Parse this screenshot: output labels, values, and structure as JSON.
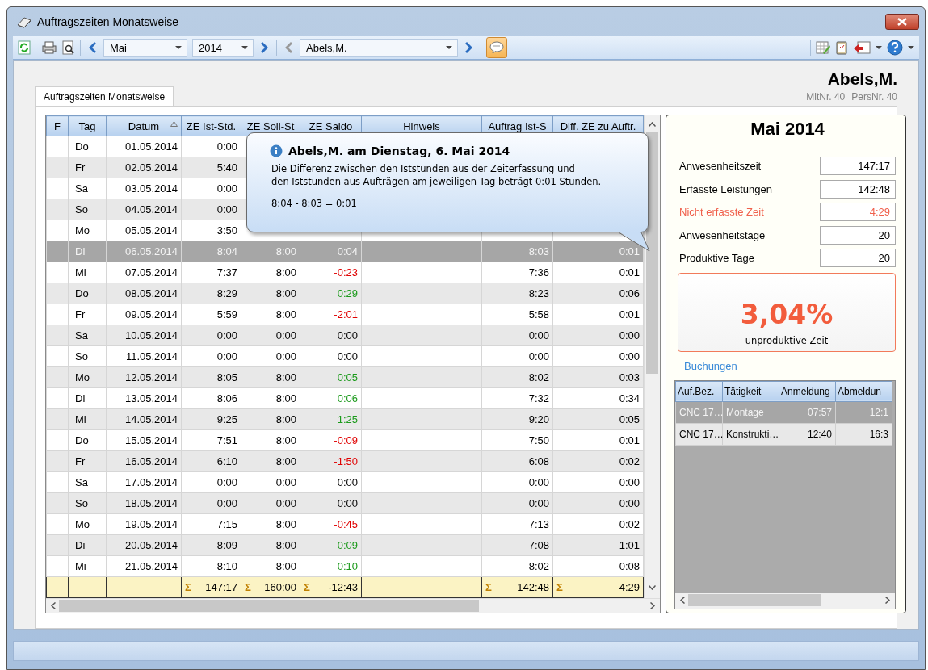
{
  "window": {
    "title": "Auftragszeiten Monatsweise"
  },
  "toolbar": {
    "month": "Mai",
    "year": "2014",
    "employee": "Abels,M.",
    "comments_on": true
  },
  "header": {
    "name": "Abels,M.",
    "mitnr": "MitNr. 40",
    "persnr": "PersNr. 40"
  },
  "tabs": [
    {
      "label": "Auftragszeiten Monatsweise",
      "selected": true
    }
  ],
  "table": {
    "columns": [
      "F",
      "Tag",
      "Datum",
      "ZE Ist-Std.",
      "ZE Soll-St",
      "ZE Saldo",
      "Hinweis",
      "Auftrag Ist-S",
      "Diff. ZE zu Auftr."
    ],
    "rows": [
      {
        "selected": false,
        "tag": "Do",
        "datum": "01.05.2014",
        "ze_ist_std": "0:00"
      },
      {
        "selected": false,
        "tag": "Fr",
        "datum": "02.05.2014",
        "ze_ist_std": "5:40"
      },
      {
        "selected": false,
        "tag": "Sa",
        "datum": "03.05.2014",
        "ze_ist_std": "0:00"
      },
      {
        "selected": false,
        "tag": "So",
        "datum": "04.05.2014",
        "ze_ist_std": "0:00"
      },
      {
        "selected": false,
        "tag": "Mo",
        "datum": "05.05.2014",
        "ze_ist_std": "3:50"
      },
      {
        "selected": true,
        "tag": "Di",
        "datum": "06.05.2014",
        "ze_ist_std": "8:04",
        "ze_soll_st": "8:00",
        "ze_saldo": "0:04",
        "auftrag_ist_s": "8:03",
        "diff_ze_zu_auftr": "0:01"
      },
      {
        "selected": false,
        "tag": "Mi",
        "datum": "07.05.2014",
        "ze_ist_std": "7:37",
        "ze_soll_st": "8:00",
        "ze_saldo": "-0:23",
        "auftrag_ist_s": "7:36",
        "diff_ze_zu_auftr": "0:01"
      },
      {
        "selected": false,
        "tag": "Do",
        "datum": "08.05.2014",
        "ze_ist_std": "8:29",
        "ze_soll_st": "8:00",
        "ze_saldo": "0:29",
        "auftrag_ist_s": "8:23",
        "diff_ze_zu_auftr": "0:06"
      },
      {
        "selected": false,
        "tag": "Fr",
        "datum": "09.05.2014",
        "ze_ist_std": "5:59",
        "ze_soll_st": "8:00",
        "ze_saldo": "-2:01",
        "auftrag_ist_s": "5:58",
        "diff_ze_zu_auftr": "0:01"
      },
      {
        "selected": false,
        "tag": "Sa",
        "datum": "10.05.2014",
        "ze_ist_std": "0:00",
        "ze_soll_st": "0:00",
        "ze_saldo": "0:00",
        "auftrag_ist_s": "0:00",
        "diff_ze_zu_auftr": "0:00"
      },
      {
        "selected": false,
        "tag": "So",
        "datum": "11.05.2014",
        "ze_ist_std": "0:00",
        "ze_soll_st": "0:00",
        "ze_saldo": "0:00",
        "auftrag_ist_s": "0:00",
        "diff_ze_zu_auftr": "0:00"
      },
      {
        "selected": false,
        "tag": "Mo",
        "datum": "12.05.2014",
        "ze_ist_std": "8:05",
        "ze_soll_st": "8:00",
        "ze_saldo": "0:05",
        "auftrag_ist_s": "8:02",
        "diff_ze_zu_auftr": "0:03"
      },
      {
        "selected": false,
        "tag": "Di",
        "datum": "13.05.2014",
        "ze_ist_std": "8:06",
        "ze_soll_st": "8:00",
        "ze_saldo": "0:06",
        "auftrag_ist_s": "7:32",
        "diff_ze_zu_auftr": "0:34"
      },
      {
        "selected": false,
        "tag": "Mi",
        "datum": "14.05.2014",
        "ze_ist_std": "9:25",
        "ze_soll_st": "8:00",
        "ze_saldo": "1:25",
        "auftrag_ist_s": "9:20",
        "diff_ze_zu_auftr": "0:05"
      },
      {
        "selected": false,
        "tag": "Do",
        "datum": "15.05.2014",
        "ze_ist_std": "7:51",
        "ze_soll_st": "8:00",
        "ze_saldo": "-0:09",
        "auftrag_ist_s": "7:50",
        "diff_ze_zu_auftr": "0:01"
      },
      {
        "selected": false,
        "tag": "Fr",
        "datum": "16.05.2014",
        "ze_ist_std": "6:10",
        "ze_soll_st": "8:00",
        "ze_saldo": "-1:50",
        "auftrag_ist_s": "6:08",
        "diff_ze_zu_auftr": "0:02"
      },
      {
        "selected": false,
        "tag": "Sa",
        "datum": "17.05.2014",
        "ze_ist_std": "0:00",
        "ze_soll_st": "0:00",
        "ze_saldo": "0:00",
        "auftrag_ist_s": "0:00",
        "diff_ze_zu_auftr": "0:00"
      },
      {
        "selected": false,
        "tag": "So",
        "datum": "18.05.2014",
        "ze_ist_std": "0:00",
        "ze_soll_st": "0:00",
        "ze_saldo": "0:00",
        "auftrag_ist_s": "0:00",
        "diff_ze_zu_auftr": "0:00"
      },
      {
        "selected": false,
        "tag": "Mo",
        "datum": "19.05.2014",
        "ze_ist_std": "7:15",
        "ze_soll_st": "8:00",
        "ze_saldo": "-0:45",
        "auftrag_ist_s": "7:13",
        "diff_ze_zu_auftr": "0:02"
      },
      {
        "selected": false,
        "tag": "Di",
        "datum": "20.05.2014",
        "ze_ist_std": "8:09",
        "ze_soll_st": "8:00",
        "ze_saldo": "0:09",
        "auftrag_ist_s": "7:08",
        "diff_ze_zu_auftr": "1:01"
      },
      {
        "selected": false,
        "tag": "Mi",
        "datum": "21.05.2014",
        "ze_ist_std": "8:10",
        "ze_soll_st": "8:00",
        "ze_saldo": "0:10",
        "auftrag_ist_s": "8:02",
        "diff_ze_zu_auftr": "0:08"
      }
    ],
    "totals": {
      "ze_ist_std": {
        "symbol": "Σ",
        "value": "147:17"
      },
      "ze_soll_st": {
        "symbol": "Σ",
        "value": "160:00"
      },
      "ze_saldo": {
        "symbol": "Σ",
        "value": "-12:43"
      },
      "auftrag_ist_s": {
        "symbol": "Σ",
        "value": "142:48"
      },
      "diff_ze_zu_auftr": {
        "symbol": "Σ",
        "value": "4:29"
      }
    }
  },
  "tooltip": {
    "title": "Abels,M. am Dienstag, 6. Mai 2014",
    "lines": [
      "Die Differenz zwischen den Iststunden aus der Zeiterfassung und",
      "den Iststunden aus Aufträgen am jeweiligen Tag beträgt 0:01 Stunden."
    ],
    "formula": "8:04 - 8:03 = 0:01"
  },
  "summary": {
    "title": "Mai 2014",
    "stats": [
      {
        "label": "Anwesenheitszeit",
        "value": "147:17",
        "alert": false
      },
      {
        "label": "Erfasste Leistungen",
        "value": "142:48",
        "alert": false
      },
      {
        "label": "Nicht erfasste Zeit",
        "value": "4:29",
        "alert": true
      },
      {
        "label": "Anwesenheitstage",
        "value": "20",
        "alert": false
      },
      {
        "label": "Produktive Tage",
        "value": "20",
        "alert": false
      }
    ],
    "percent": "3,04%",
    "percent_label": "unproduktive Zeit",
    "group": "Buchungen",
    "bookings": {
      "columns": [
        "Auf.Bez.",
        "Tätigkeit",
        "Anmeldung",
        "Abmeldun"
      ],
      "rows": [
        {
          "selected": true,
          "cells": [
            "CNC 17…",
            "Montage",
            "07:57",
            "12:1"
          ]
        },
        {
          "selected": false,
          "cells": [
            "CNC 17…",
            "Konstrukti…",
            "12:40",
            "16:3"
          ]
        }
      ]
    }
  }
}
